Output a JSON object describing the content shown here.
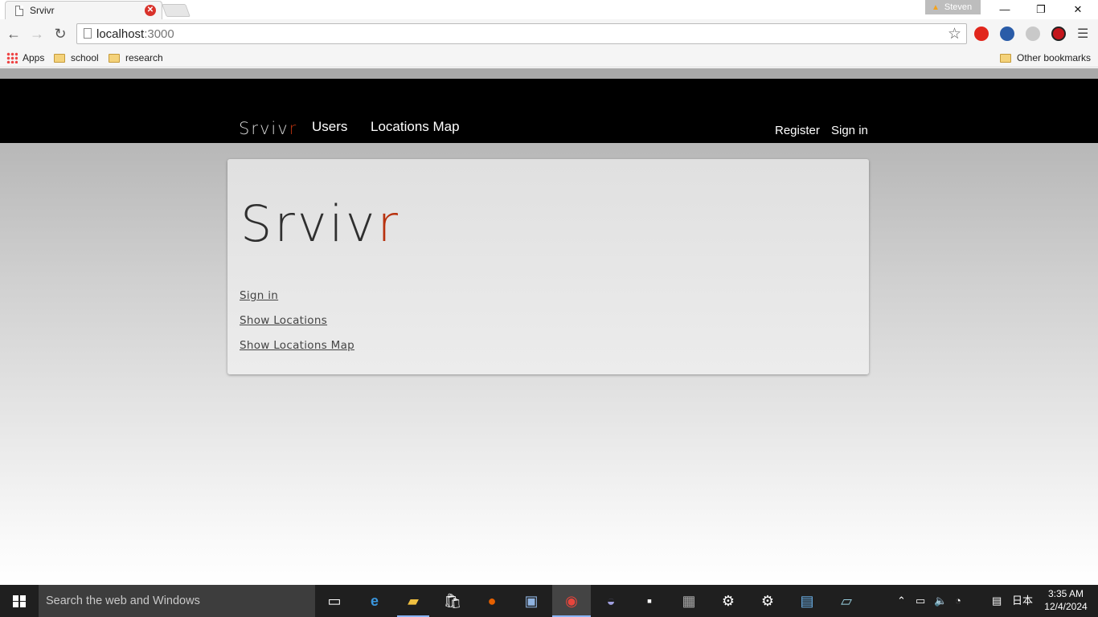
{
  "browser": {
    "tab_title": "Srvivr",
    "profile_name": "Steven",
    "url_host": "localhost",
    "url_port": ":3000",
    "bookmarks": {
      "apps": "Apps",
      "items": [
        "school",
        "research"
      ],
      "other": "Other bookmarks"
    }
  },
  "site": {
    "brand_main": "Srviv",
    "brand_accent": "r",
    "nav": {
      "users": "Users",
      "locations_map": "Locations Map"
    },
    "auth": {
      "register": "Register",
      "sign_in": "Sign in"
    },
    "accent_color": "#b8320f"
  },
  "card": {
    "logo_main": "Srviv",
    "logo_accent": "r",
    "links": [
      "Sign in",
      "Show Locations",
      "Show Locations Map"
    ]
  },
  "taskbar": {
    "search_placeholder": "Search the web and Windows",
    "ime": "日本",
    "time": "3:35 AM",
    "date": "12/4/2024"
  }
}
